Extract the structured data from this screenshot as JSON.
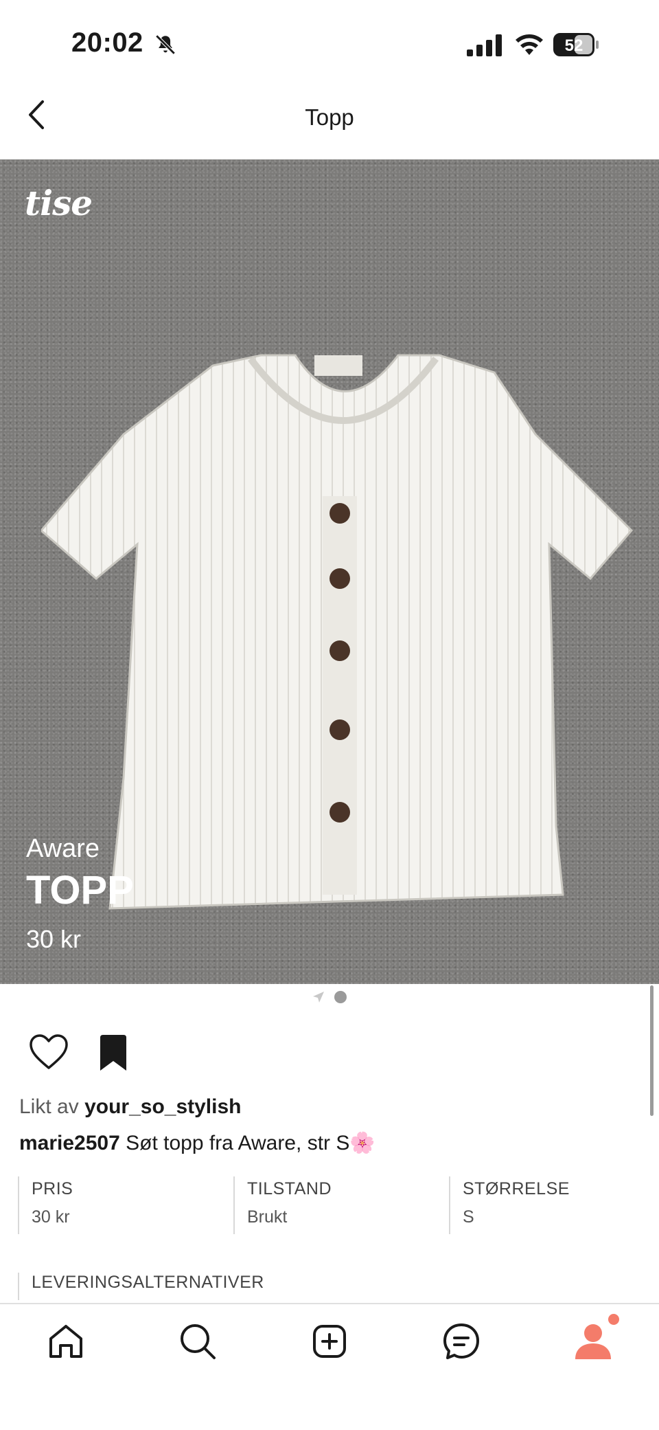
{
  "status_bar": {
    "time": "20:02",
    "battery": "52"
  },
  "nav": {
    "title": "Topp"
  },
  "product_image": {
    "brand_logo": "tise",
    "overlay_brand": "Aware",
    "overlay_title": "TOPP",
    "overlay_price": "30 kr"
  },
  "social": {
    "liked_prefix": "Likt av",
    "liked_user": "your_so_stylish",
    "caption_user": "marie2507",
    "caption_text": " Søt topp fra Aware, str S🌸"
  },
  "details": [
    {
      "label": "PRIS",
      "value": "30 kr"
    },
    {
      "label": "TILSTAND",
      "value": "Brukt"
    },
    {
      "label": "STØRRELSE",
      "value": "S"
    }
  ],
  "delivery_label": "LEVERINGSALTERNATIVER",
  "tabs": [
    "home-icon",
    "search-icon",
    "add-icon",
    "messages-icon",
    "profile-icon"
  ],
  "colors": {
    "accent": "#f47c6a",
    "image_bg": "#7c7b79",
    "text": "#1a1a1a"
  }
}
